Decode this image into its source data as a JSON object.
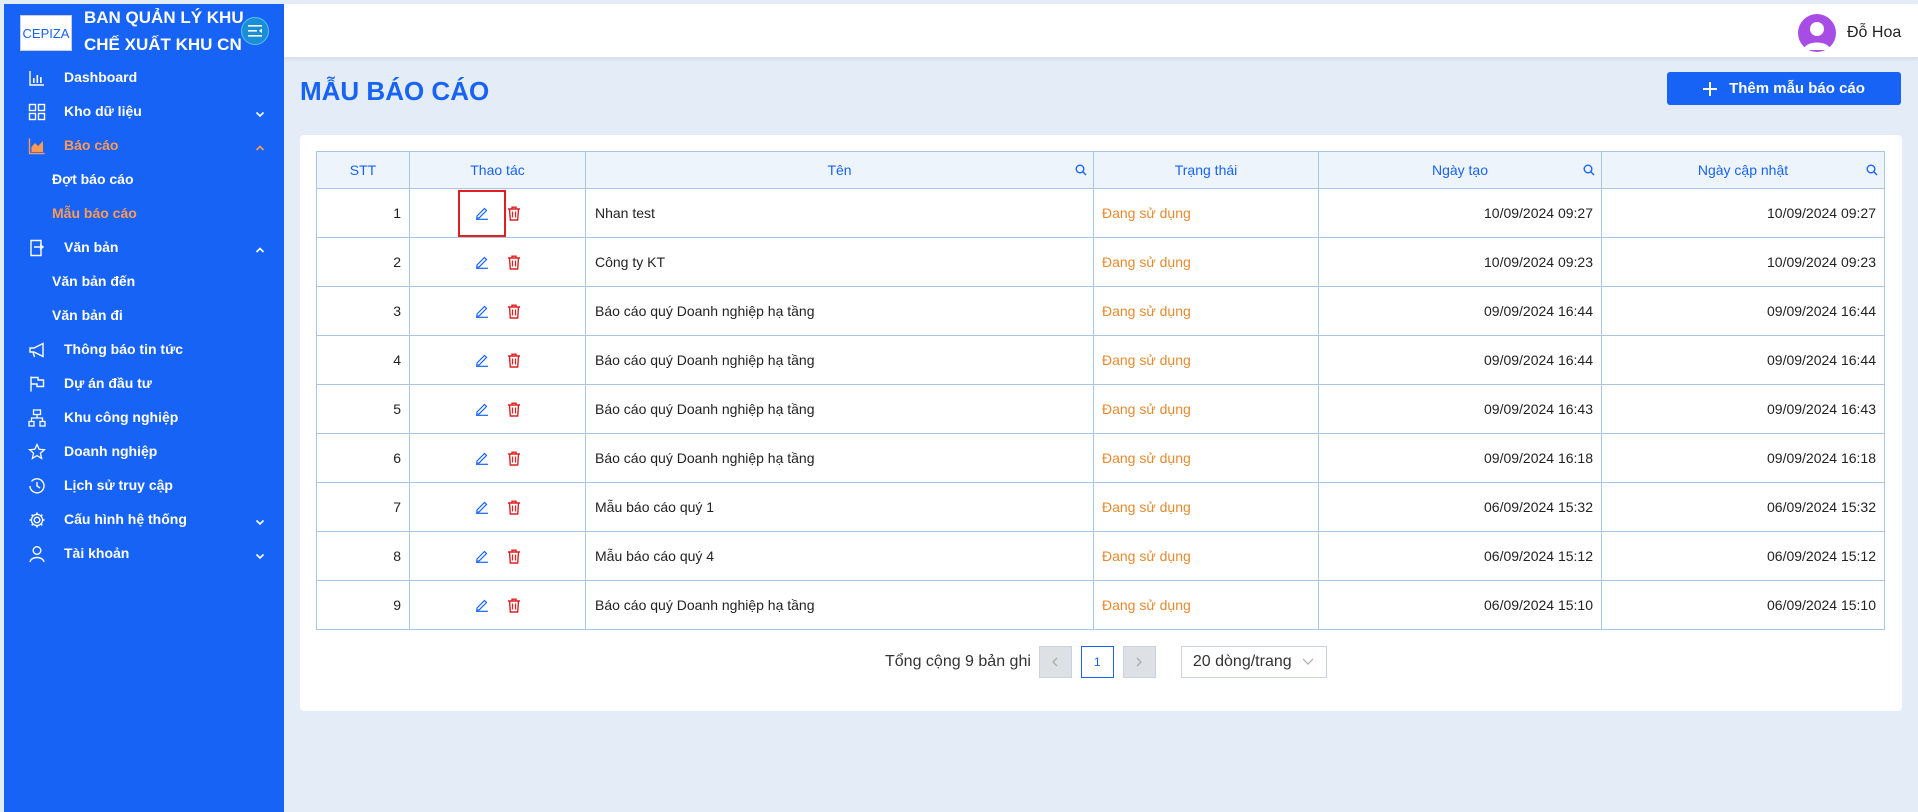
{
  "brand": {
    "logo_text": "CEPIZA",
    "line1": "BAN QUẢN LÝ KHU",
    "line2": "CHẾ XUẤT KHU CN"
  },
  "sidebar": {
    "items": [
      {
        "label": "Dashboard",
        "icon": "chart-bar-icon"
      },
      {
        "label": "Kho dữ liệu",
        "icon": "grid-icon",
        "expandable": true
      },
      {
        "label": "Báo cáo",
        "icon": "area-chart-icon",
        "expandable": true,
        "active": true
      },
      {
        "label": "Đợt báo cáo",
        "sub": true
      },
      {
        "label": "Mẫu báo cáo",
        "sub": true,
        "active": true
      },
      {
        "label": "Văn bản",
        "icon": "document-icon",
        "expandable": true
      },
      {
        "label": "Văn bản đến",
        "sub": true
      },
      {
        "label": "Văn bản đi",
        "sub": true
      },
      {
        "label": "Thông báo tin tức",
        "icon": "megaphone-icon"
      },
      {
        "label": "Dự án đầu tư",
        "icon": "flag-icon"
      },
      {
        "label": "Khu công nghiệp",
        "icon": "org-chart-icon"
      },
      {
        "label": "Doanh nghiệp",
        "icon": "star-icon"
      },
      {
        "label": "Lịch sử truy cập",
        "icon": "history-icon"
      },
      {
        "label": "Cấu hình hệ thống",
        "icon": "gear-icon",
        "expandable": true
      },
      {
        "label": "Tài khoản",
        "icon": "user-icon",
        "expandable": true
      }
    ]
  },
  "header": {
    "username": "Đỗ Hoa"
  },
  "page": {
    "title": "MẪU BÁO CÁO",
    "add_button": "Thêm mẫu báo cáo"
  },
  "table": {
    "columns": [
      "STT",
      "Thao tác",
      "Tên",
      "Trạng thái",
      "Ngày tạo",
      "Ngày cập nhật"
    ],
    "rows": [
      {
        "stt": "1",
        "name": "Nhan test",
        "status": "Đang sử dụng",
        "created": "10/09/2024 09:27",
        "updated": "10/09/2024 09:27"
      },
      {
        "stt": "2",
        "name": "Công ty KT",
        "status": "Đang sử dụng",
        "created": "10/09/2024 09:23",
        "updated": "10/09/2024 09:23"
      },
      {
        "stt": "3",
        "name": "Báo cáo quý Doanh nghiệp hạ tầng",
        "status": "Đang sử dụng",
        "created": "09/09/2024 16:44",
        "updated": "09/09/2024 16:44"
      },
      {
        "stt": "4",
        "name": "Báo cáo quý Doanh nghiệp hạ tầng",
        "status": "Đang sử dụng",
        "created": "09/09/2024 16:44",
        "updated": "09/09/2024 16:44"
      },
      {
        "stt": "5",
        "name": "Báo cáo quý Doanh nghiệp hạ tầng",
        "status": "Đang sử dụng",
        "created": "09/09/2024 16:43",
        "updated": "09/09/2024 16:43"
      },
      {
        "stt": "6",
        "name": "Báo cáo quý Doanh nghiệp hạ tầng",
        "status": "Đang sử dụng",
        "created": "09/09/2024 16:18",
        "updated": "09/09/2024 16:18"
      },
      {
        "stt": "7",
        "name": "Mẫu báo cáo quý 1",
        "status": "Đang sử dụng",
        "created": "06/09/2024 15:32",
        "updated": "06/09/2024 15:32"
      },
      {
        "stt": "8",
        "name": "Mẫu báo cáo quý 4",
        "status": "Đang sử dụng",
        "created": "06/09/2024 15:12",
        "updated": "06/09/2024 15:12"
      },
      {
        "stt": "9",
        "name": "Báo cáo quý Doanh nghiệp hạ tầng",
        "status": "Đang sử dụng",
        "created": "06/09/2024 15:10",
        "updated": "06/09/2024 15:10"
      }
    ]
  },
  "pagination": {
    "total": "Tổng cộng 9 bản ghi",
    "current_page": "1",
    "page_size": "20 dòng/trang"
  },
  "colors": {
    "primary": "#1763f5",
    "active_menu": "#ff9a52",
    "status": "#e68a2e",
    "delete": "#e02020"
  }
}
